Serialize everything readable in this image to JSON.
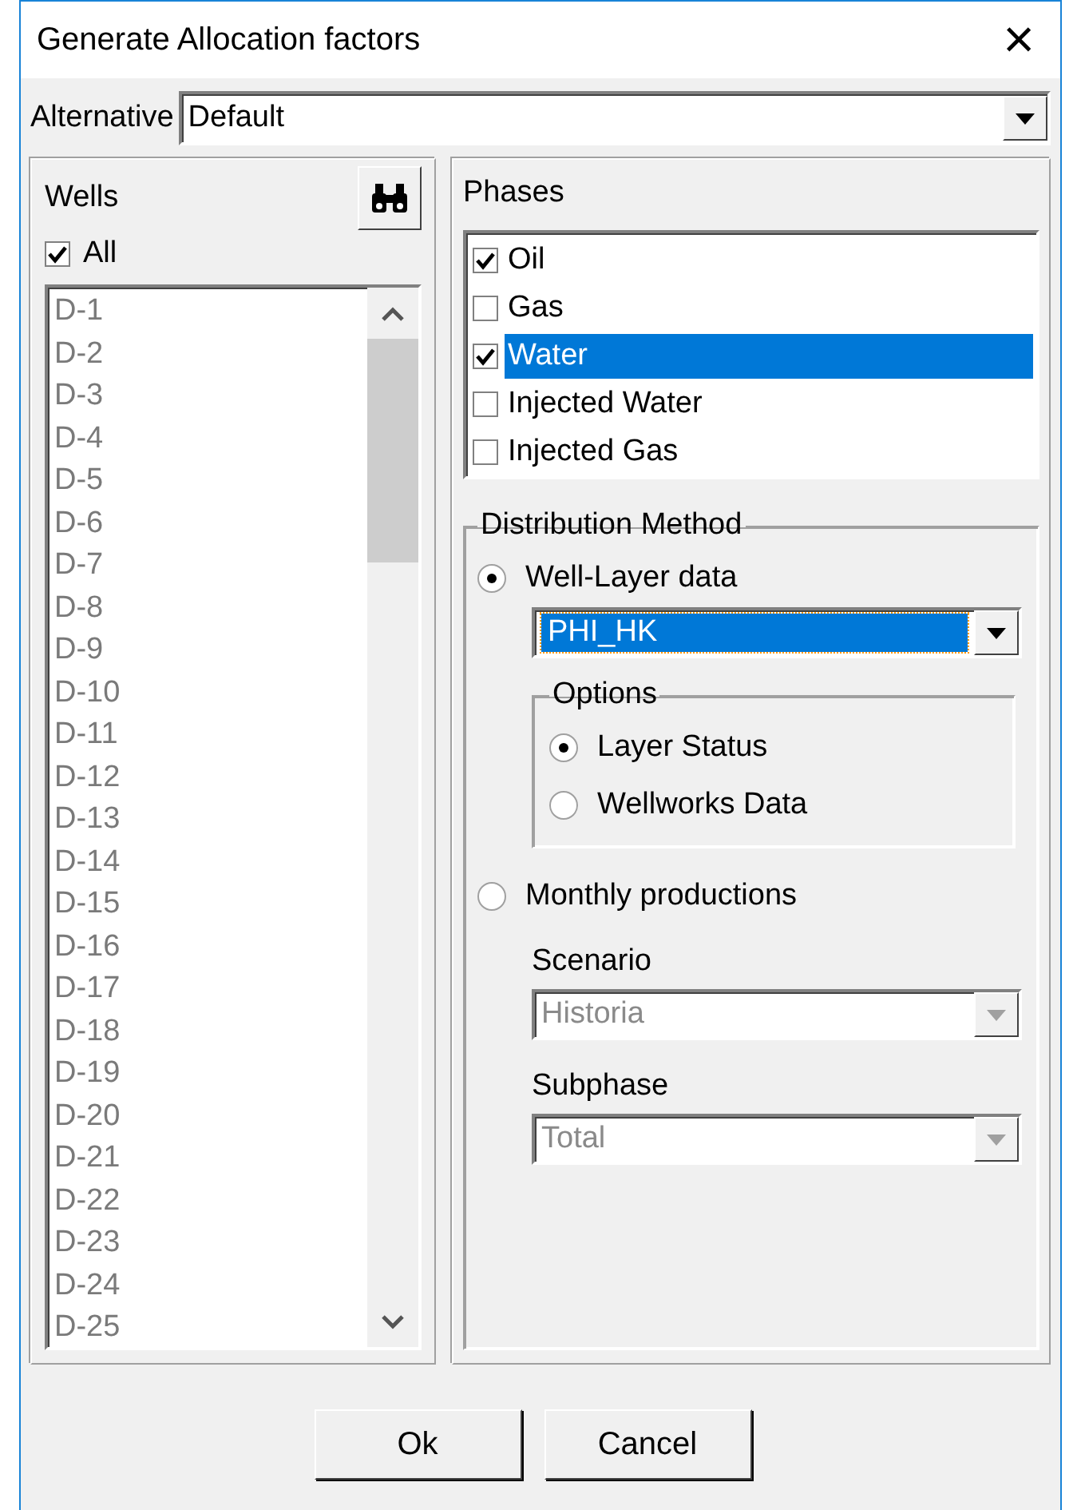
{
  "window": {
    "title": "Generate Allocation factors",
    "close": "×"
  },
  "alternative": {
    "label": "Alternative",
    "value": "Default"
  },
  "wells": {
    "label": "Wells",
    "all": {
      "label": "All",
      "checked": true
    },
    "items_disabled": true,
    "items": [
      "D-1",
      "D-2",
      "D-3",
      "D-4",
      "D-5",
      "D-6",
      "D-7",
      "D-8",
      "D-9",
      "D-10",
      "D-11",
      "D-12",
      "D-13",
      "D-14",
      "D-15",
      "D-16",
      "D-17",
      "D-18",
      "D-19",
      "D-20",
      "D-21",
      "D-22",
      "D-23",
      "D-24",
      "D-25"
    ]
  },
  "phases": {
    "label": "Phases",
    "items": [
      {
        "label": "Oil",
        "checked": true,
        "selected": false
      },
      {
        "label": "Gas",
        "checked": false,
        "selected": false
      },
      {
        "label": "Water",
        "checked": true,
        "selected": true
      },
      {
        "label": "Injected Water",
        "checked": false,
        "selected": false
      },
      {
        "label": "Injected Gas",
        "checked": false,
        "selected": false
      }
    ]
  },
  "distribution_method": {
    "label": "Distribution Method",
    "well_layer": {
      "label": "Well-Layer data",
      "selected": true,
      "combo": {
        "value": "PHI_HK",
        "highlighted": true,
        "disabled": false
      },
      "options": {
        "label": "Options",
        "items": [
          {
            "label": "Layer Status",
            "selected": true
          },
          {
            "label": "Wellworks Data",
            "selected": false
          }
        ]
      }
    },
    "monthly": {
      "label": "Monthly productions",
      "selected": false,
      "scenario": {
        "label": "Scenario",
        "value": "Historia",
        "disabled": true
      },
      "subphase": {
        "label": "Subphase",
        "value": "Total",
        "disabled": true
      }
    }
  },
  "buttons": [
    "Ok",
    "Cancel"
  ]
}
